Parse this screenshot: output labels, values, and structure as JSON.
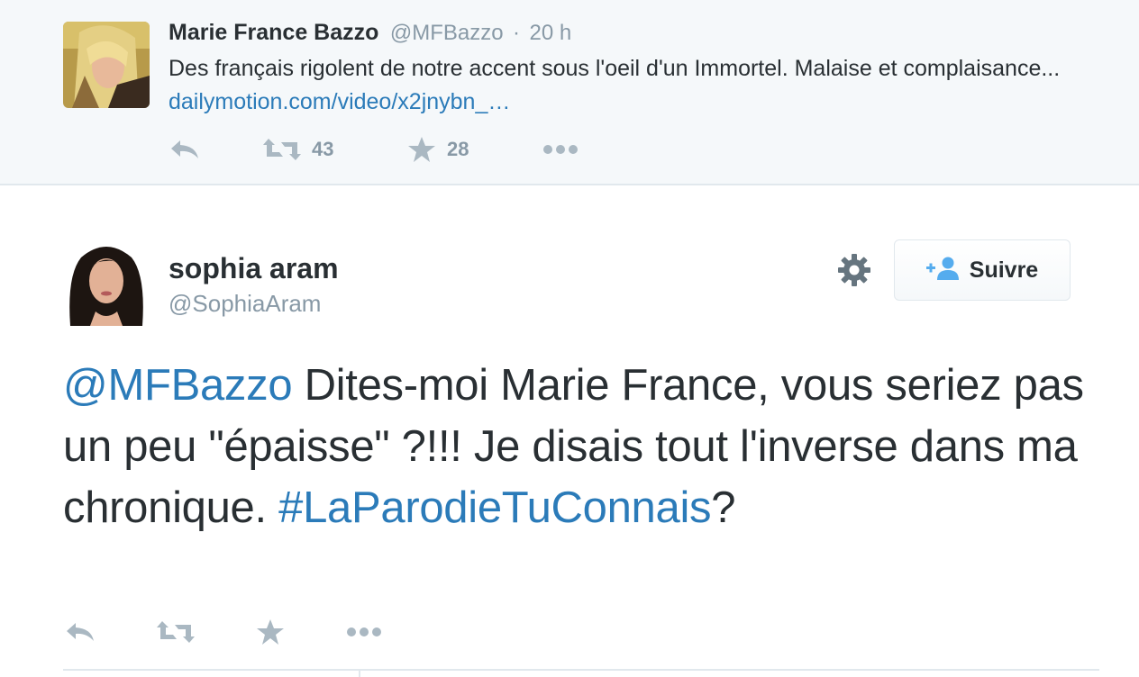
{
  "parent_tweet": {
    "author_name": "Marie France Bazzo",
    "author_handle": "@MFBazzo",
    "separator": "·",
    "time": "20 h",
    "text": "Des français rigolent de notre accent sous l'oeil d'un Immortel. Malaise et complaisance... ",
    "link": "dailymotion.com/video/x2jnybn_…",
    "retweet_count": "43",
    "favorite_count": "28"
  },
  "main_tweet": {
    "author_name": "sophia aram",
    "author_handle": "@SophiaAram",
    "follow_label": "Suivre",
    "mention": "@MFBazzo",
    "text": " Dites-moi Marie France, vous seriez pas un peu \"épaisse\" ?!!! Je disais tout l'inverse dans ma chronique. ",
    "hashtag": "#LaParodieTuConnais",
    "text_end": "?"
  },
  "icons": {
    "reply": "reply-icon",
    "retweet": "retweet-icon",
    "favorite": "star-icon",
    "more": "more-icon",
    "settings": "gear-icon",
    "follow": "add-user-icon"
  },
  "colors": {
    "link": "#2b7bb9",
    "icon_gray": "#aab8c2",
    "parent_background": "#f5f8fa",
    "text": "#292f33",
    "meta": "#8899a6"
  }
}
